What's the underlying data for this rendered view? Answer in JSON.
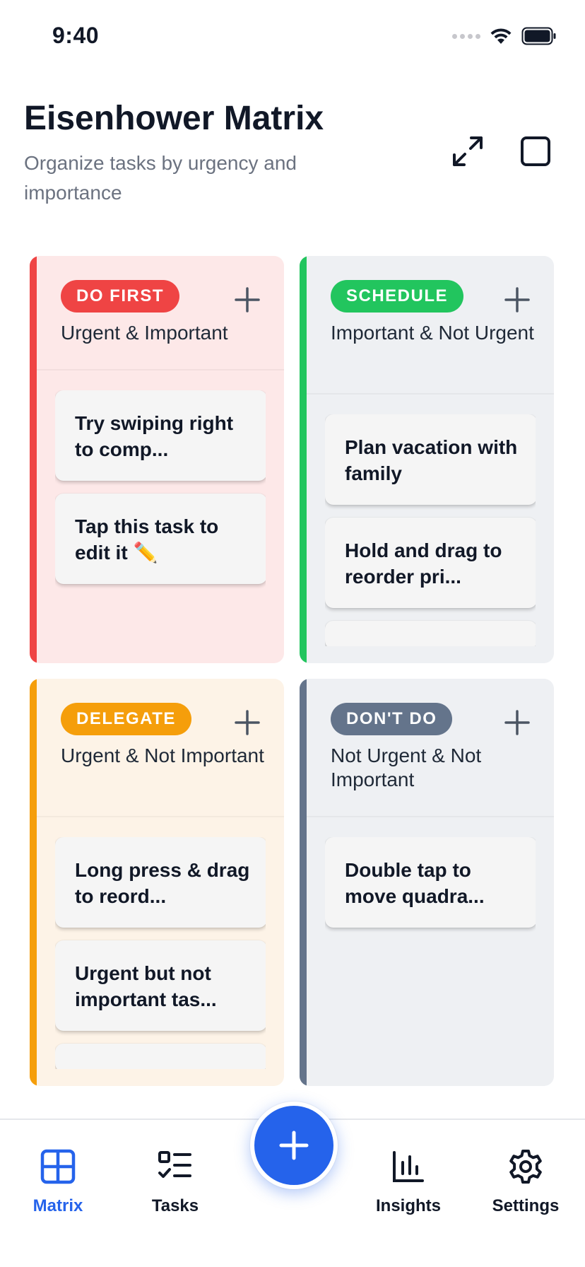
{
  "status_bar": {
    "time": "9:40"
  },
  "header": {
    "title": "Eisenhower Matrix",
    "subtitle": "Organize tasks by urgency and importance",
    "expand_icon": "expand-arrows-icon",
    "fullscreen_icon": "square-icon"
  },
  "quadrants": {
    "do_first": {
      "badge": "DO FIRST",
      "subtitle": "Urgent & Important",
      "color": "#ef4444",
      "bg": "#fde8e8",
      "tasks": [
        "Try swiping right to comp...",
        "Tap this task to edit it ✏️"
      ]
    },
    "schedule": {
      "badge": "SCHEDULE",
      "subtitle": "Important & Not Urgent",
      "color": "#22c55e",
      "bg": "#eef0f3",
      "tasks": [
        "Plan vacation with family",
        "Hold and drag to reorder pri..."
      ]
    },
    "delegate": {
      "badge": "DELEGATE",
      "subtitle": "Urgent & Not Important",
      "color": "#f59e0b",
      "bg": "#fdf3e7",
      "tasks": [
        "Long press & drag to reord...",
        "Urgent but not important tas..."
      ]
    },
    "dont_do": {
      "badge": "DON'T DO",
      "subtitle": "Not Urgent & Not Important",
      "color": "#64748b",
      "bg": "#eef0f3",
      "tasks": [
        "Double tap to move quadra..."
      ]
    }
  },
  "nav": {
    "matrix": "Matrix",
    "tasks": "Tasks",
    "insights": "Insights",
    "settings": "Settings",
    "active": "matrix",
    "accent": "#2563eb"
  }
}
